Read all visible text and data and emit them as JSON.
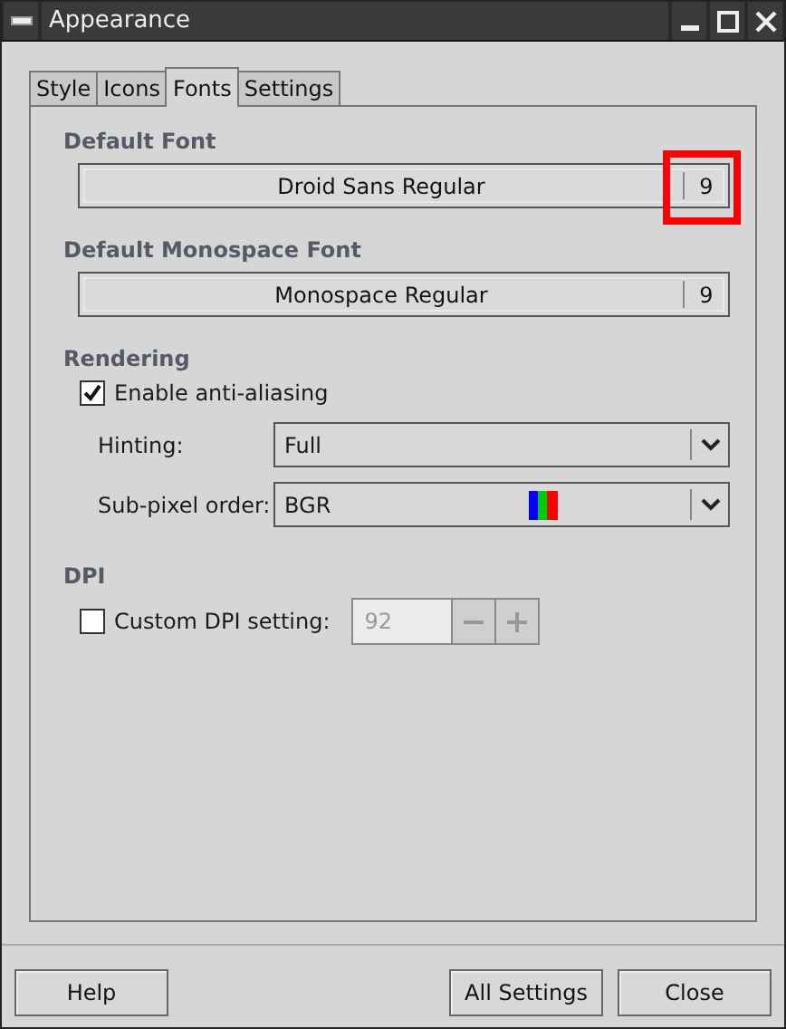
{
  "window": {
    "title": "Appearance"
  },
  "tabs": [
    {
      "label": "Style",
      "selected": false
    },
    {
      "label": "Icons",
      "selected": false
    },
    {
      "label": "Fonts",
      "selected": true
    },
    {
      "label": "Settings",
      "selected": false
    }
  ],
  "default_font": {
    "heading": "Default Font",
    "name": "Droid Sans Regular",
    "size": "9",
    "highlighted": true
  },
  "monospace_font": {
    "heading": "Default Monospace Font",
    "name": "Monospace Regular",
    "size": "9"
  },
  "rendering": {
    "heading": "Rendering",
    "antialiasing": {
      "label": "Enable anti-aliasing",
      "checked": true
    },
    "hinting": {
      "label": "Hinting:",
      "value": "Full"
    },
    "subpixel_order": {
      "label": "Sub-pixel order:",
      "value": "BGR"
    }
  },
  "dpi": {
    "heading": "DPI",
    "custom": {
      "label": "Custom DPI setting:",
      "checked": false
    },
    "value": "92",
    "disabled": true
  },
  "buttons": [
    {
      "label": "Help"
    },
    {
      "label": "All Settings"
    },
    {
      "label": "Close"
    }
  ]
}
